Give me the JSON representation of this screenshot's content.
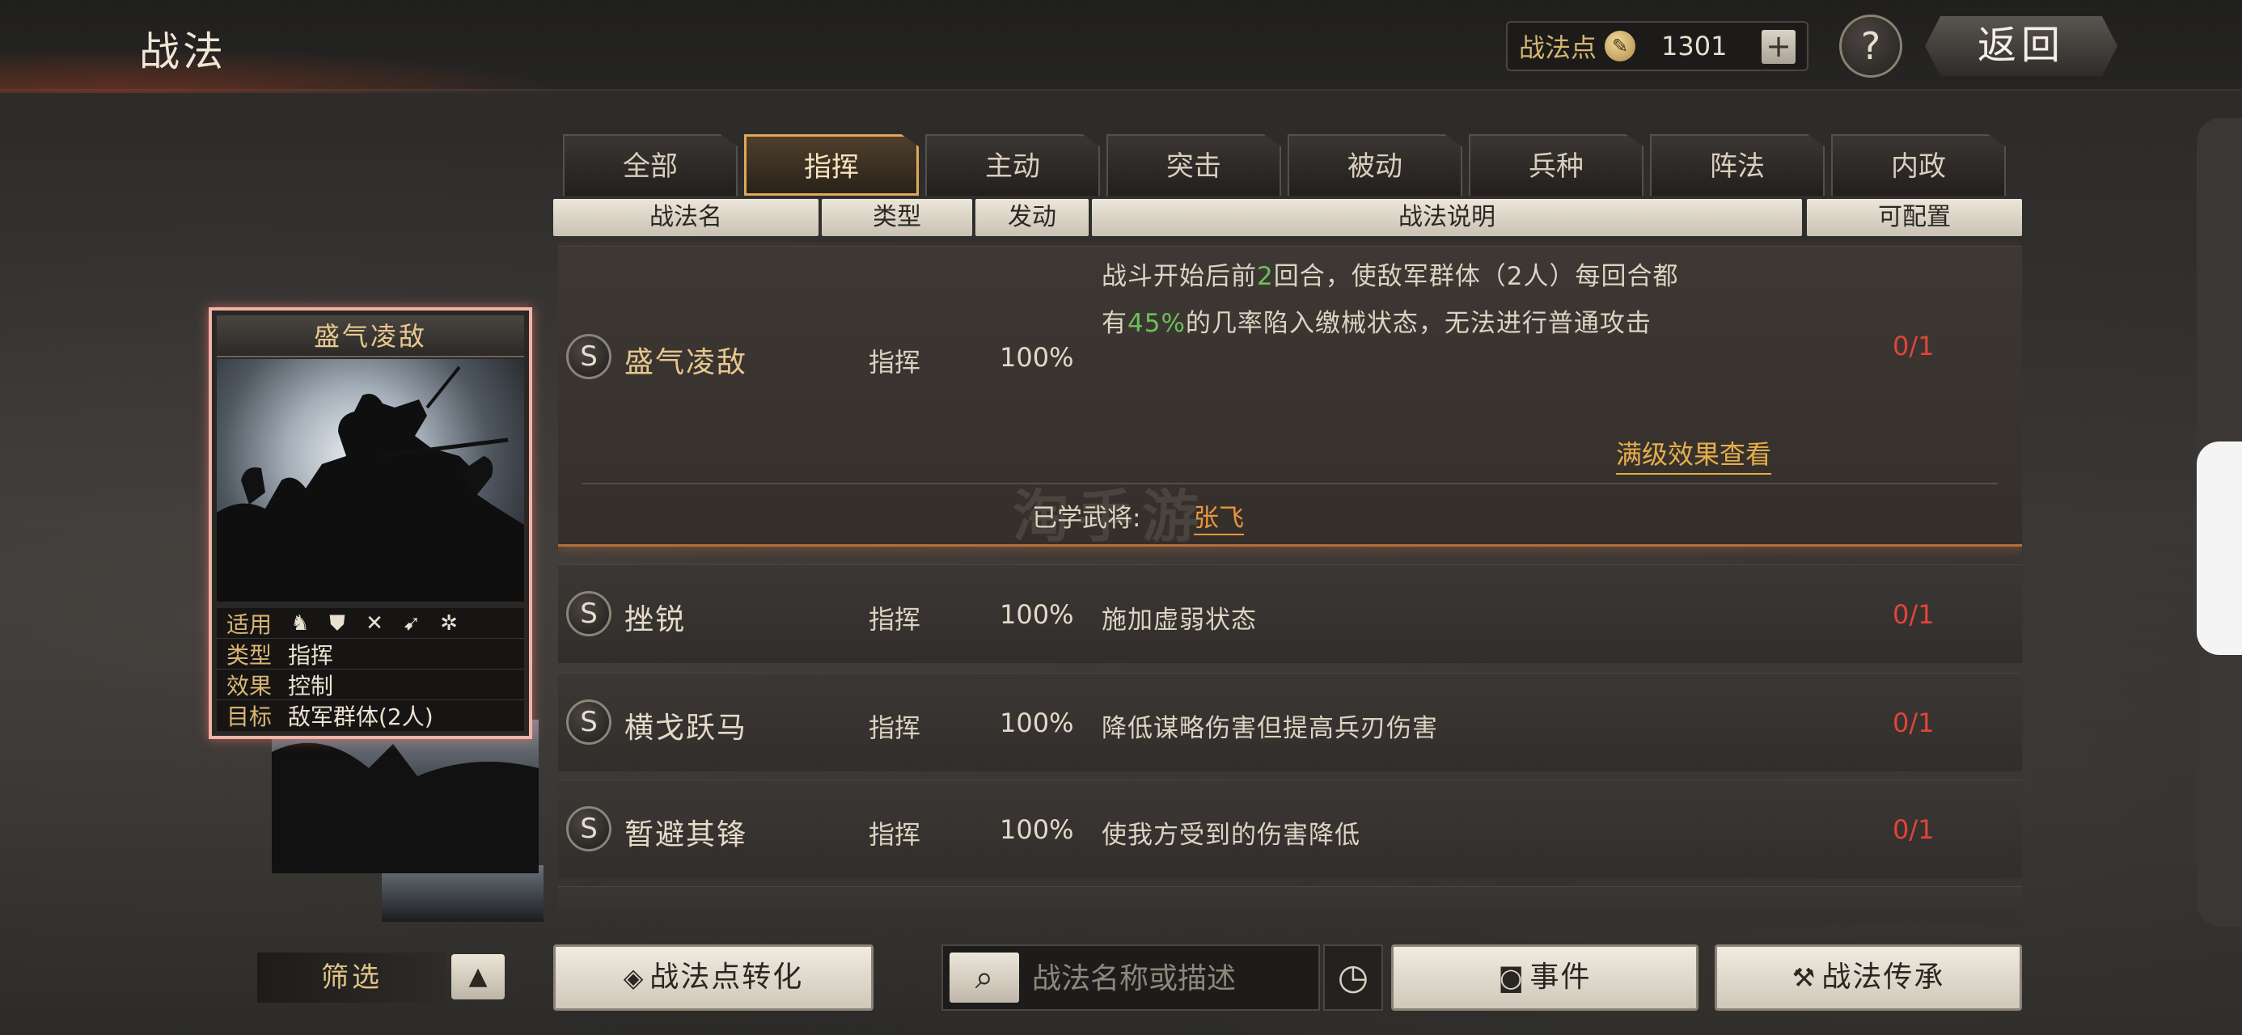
{
  "header": {
    "title": "战法",
    "points_label": "战法点",
    "points_value": "1301",
    "plus_label": "+",
    "help_label": "?",
    "back_label": "返回"
  },
  "tabs": [
    {
      "label": "全部",
      "active": false
    },
    {
      "label": "指挥",
      "active": true
    },
    {
      "label": "主动",
      "active": false
    },
    {
      "label": "突击",
      "active": false
    },
    {
      "label": "被动",
      "active": false
    },
    {
      "label": "兵种",
      "active": false
    },
    {
      "label": "阵法",
      "active": false
    },
    {
      "label": "内政",
      "active": false
    }
  ],
  "columns": {
    "name": "战法名",
    "type": "类型",
    "trigger": "发动",
    "desc": "战法说明",
    "config": "可配置"
  },
  "rows": [
    {
      "rank": "S",
      "name": "盛气凌敌",
      "type": "指挥",
      "rate": "100%",
      "desc_part1": "战斗开始后前",
      "desc_num1": "2",
      "desc_part2": "回合，使敌军群体（2人）每回合都",
      "desc_part3": "有",
      "desc_num2": "45%",
      "desc_part4": "的几率陷入缴械状态，无法进行普通攻击",
      "quota": "0/1",
      "max_level_link": "满级效果查看",
      "learned_label": "已学武将:",
      "learned_general": "张飞"
    },
    {
      "rank": "S",
      "name": "挫锐",
      "type": "指挥",
      "rate": "100%",
      "desc": "施加虚弱状态",
      "quota": "0/1"
    },
    {
      "rank": "S",
      "name": "横戈跃马",
      "type": "指挥",
      "rate": "100%",
      "desc": "降低谋略伤害但提高兵刃伤害",
      "quota": "0/1"
    },
    {
      "rank": "S",
      "name": "暂避其锋",
      "type": "指挥",
      "rate": "100%",
      "desc": "使我方受到的伤害降低",
      "quota": "0/1"
    }
  ],
  "card": {
    "title": "盛气凌敌",
    "applies_label": "适用",
    "type_label": "类型",
    "type_value": "指挥",
    "effect_label": "效果",
    "effect_value": "控制",
    "target_label": "目标",
    "target_value": "敌军群体(2人)",
    "unit_icons": [
      "cavalry-icon",
      "shield-icon",
      "bow-icon",
      "spear-icon",
      "siege-icon"
    ]
  },
  "watermark": "淘手游",
  "bottom": {
    "filter_label": "筛选",
    "filter_toggle": "▲",
    "convert_label": "战法点转化",
    "search_placeholder": "战法名称或描述",
    "event_label": "事件",
    "inherit_label": "战法传承"
  },
  "colors": {
    "accent_gold": "#e6c78e",
    "quota_red": "#e0453a",
    "highlight_green": "#6cbf5a",
    "link_orange": "#e8963f",
    "active_tab_border": "#e0a85a"
  }
}
